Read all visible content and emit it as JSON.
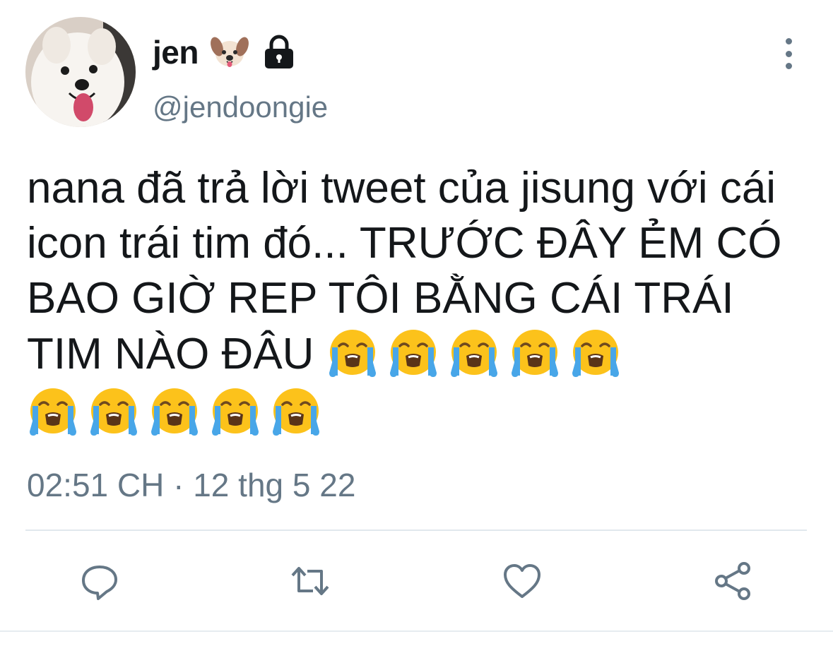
{
  "user": {
    "display_name": "jen",
    "handle": "@jendoongie",
    "name_emoji": "dog-face-icon",
    "protected_icon": "lock-icon"
  },
  "tweet": {
    "text": "nana đã trả lời tweet của jisung với cái icon trái tim đó... TRƯỚC ĐÂY ẺM CÓ BAO GIỜ REP TÔI BẰNG CÁI TRÁI TIM NÀO ĐÂU",
    "trailing_emoji": "loudly-crying-face-icon",
    "emoji_count": 10,
    "timestamp": "02:51 CH · 12 thg 5 22"
  },
  "actions": {
    "reply": "reply-icon",
    "retweet": "retweet-icon",
    "like": "heart-icon",
    "share": "share-icon"
  },
  "colors": {
    "secondary_text": "#657786",
    "primary_text": "#14171a",
    "divider": "#e1e8ed"
  }
}
